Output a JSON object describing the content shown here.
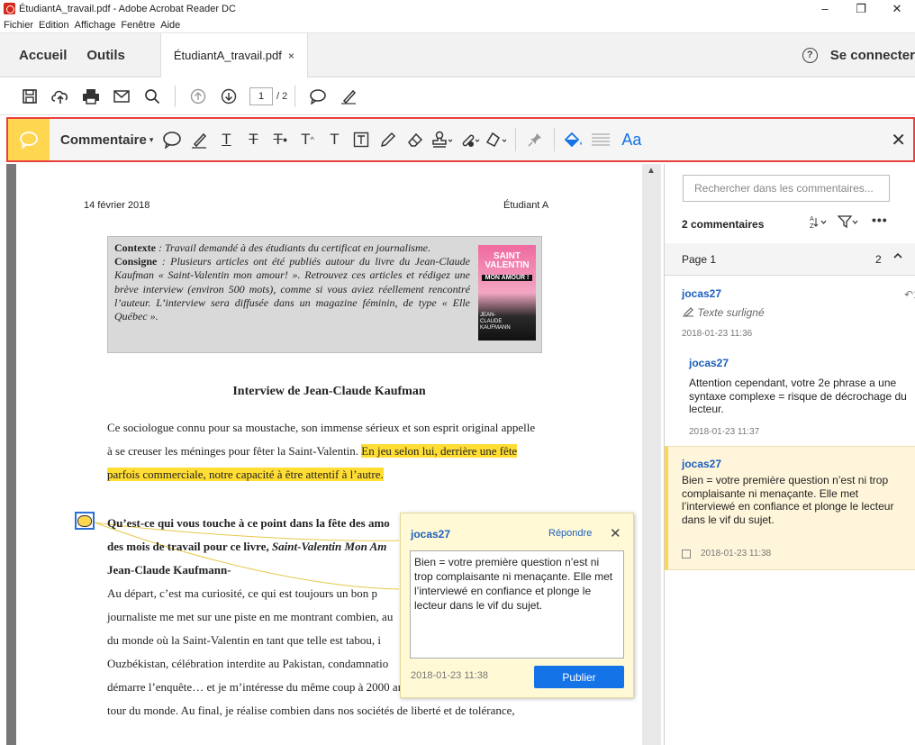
{
  "window": {
    "title": "ÉtudiantA_travail.pdf - Adobe Acrobat Reader DC",
    "minimize": "–",
    "maximize": "❐",
    "close": "✕"
  },
  "menu": [
    "Fichier",
    "Edition",
    "Affichage",
    "Fenêtre",
    "Aide"
  ],
  "tabs": {
    "home": "Accueil",
    "tools": "Outils",
    "document": "ÉtudiantA_travail.pdf",
    "document_close": "×",
    "help": "?",
    "signin": "Se connecter"
  },
  "toolbar": {
    "page_current": "1",
    "page_total": "/ 2"
  },
  "comment_toolbar": {
    "label": "Commentaire",
    "caret": "▾",
    "text_glyph_t1": "T",
    "text_glyph_t2": "T",
    "text_glyph_t3": "T",
    "text_glyph_t4": "T",
    "text_glyph_t5": "T",
    "font_label": "Aa",
    "close": "✕",
    "accent_color": "#ffd64f",
    "border_color": "#e8413d"
  },
  "page": {
    "date": "14 février 2018",
    "student": "Étudiant A",
    "box": {
      "contexte_label": "Contexte",
      "contexte_text": " : Travail demandé à des étudiants du certificat en journalisme.",
      "consigne_label": "Consigne",
      "consigne_text": " : Plusieurs articles ont été publiés autour du livre du Jean-Claude Kaufman « Saint-Valentin mon amour! ». Retrouvez ces articles et rédigez une brève interview (environ 500 mots), comme si vous aviez réellement rencontré l’auteur. L’interview sera diffusée dans un magazine féminin, de type « Elle Québec ».",
      "cover_line1": "SAINT",
      "cover_line2": "VALENTIN",
      "cover_line3": "MON AMOUR !",
      "cover_line4": "JEAN-CLAUDE",
      "cover_line5": "KAUFMANN"
    },
    "title": "Interview de Jean-Claude Kaufman",
    "para1_line1": "Ce sociologue connu pour sa moustache, son immense sérieux et son esprit original appelle",
    "para1_line2a": "à se creuser les méninges pour fêter la Saint-Valentin. ",
    "para1_line2b": "En jeu selon lui, derrière une fête",
    "para1_line3": "parfois commerciale, notre capacité à être attentif à l’autre.",
    "q1_line1": "Qu’est-ce qui vous touche à ce point dans la fête des amo",
    "q1_line2a": "des mois de travail pour ce livre, ",
    "q1_line2b": "Saint-Valentin Mon Am",
    "answer_label": "Jean-Claude Kaufmann-",
    "a1": "Au départ, c’est ma curiosité, ce qui est toujours un bon p",
    "a2": "journaliste me met sur une piste en me montrant combien, au",
    "a3": "du monde où la Saint-Valentin en tant que telle est tabou, i",
    "a4": "Ouzbékistan, célébration interdite au Pakistan, condamnatio",
    "a5": "démarre l’enquête… et je m’intéresse du même coup à 2000 ans d’Histoire en faisant le",
    "a6": "tour du monde. Au final, je réalise combien dans nos sociétés de liberté et de tolérance,"
  },
  "popup": {
    "author": "jocas27",
    "reply": "Répondre",
    "close": "✕",
    "text": "Bien = votre première question n’est ni trop complaisante ni menaçante. Elle met l’interviewé en confiance et plonge le lecteur dans le vif du sujet.",
    "timestamp": "2018-01-23  11:38",
    "publish": "Publier"
  },
  "panel": {
    "search_placeholder": "Rechercher dans les commentaires...",
    "count": "2 commentaires",
    "more": "•••",
    "page_label": "Page 1",
    "page_count": "2",
    "comments": [
      {
        "author": "jocas27",
        "kind": "Texte surligné",
        "timestamp": "2018-01-23  11:36",
        "reply_count": "1",
        "reply": {
          "author": "jocas27",
          "text": "Attention cependant, votre 2e phrase a une syntaxe complexe = risque de décrochage du lecteur.",
          "timestamp": "2018-01-23  11:37"
        }
      },
      {
        "author": "jocas27",
        "text": "Bien = votre première question n’est ni trop complaisante ni menaçante. Elle met l’interviewé en confiance et plonge le lecteur dans le vif du sujet.",
        "timestamp": "2018-01-23  11:38"
      }
    ]
  }
}
